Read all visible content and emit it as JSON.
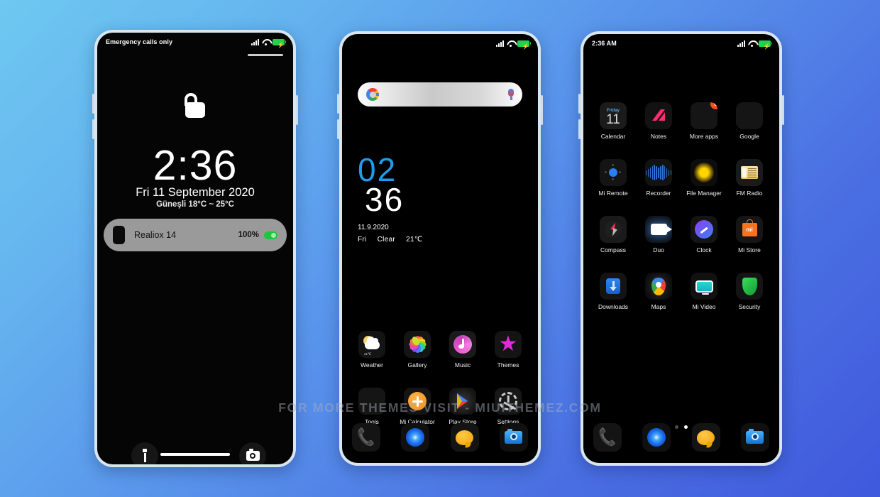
{
  "background": {
    "top_left_color": "#6ec8f0",
    "bottom_right_color": "#4059dd"
  },
  "watermark": {
    "text": "FOR MORE THEMES VISIT - MIUITHEMEZ.COM"
  },
  "lockscreen": {
    "statusbar": {
      "carrier": "Emergency calls only",
      "signal_icon": "signal-bars-icon",
      "wifi_icon": "wifi-icon",
      "battery_icon": "battery-charging-icon"
    },
    "lock_icon": "unlocked-padlock-icon",
    "time": "2:36",
    "date": "Fri 11 September 2020",
    "weather": "Güneşli  18°C ~ 25°C",
    "notification": {
      "icon": "phone-device-icon",
      "title": "Realiox 14",
      "percent": "100%",
      "battery_icon": "battery-full-icon"
    },
    "shortcuts": [
      {
        "name": "flashlight-shortcut",
        "icon": "flashlight-icon"
      },
      {
        "name": "camera-shortcut",
        "icon": "camera-icon"
      }
    ],
    "home_indicator": "home-indicator-bar"
  },
  "homescreen": {
    "statusbar": {
      "carrier": "",
      "signal_icon": "signal-bars-icon",
      "wifi_icon": "wifi-icon",
      "battery_icon": "battery-charging-icon"
    },
    "search": {
      "placeholder": "",
      "left_icon": "google-logo-icon",
      "right_icon": "microphone-icon"
    },
    "clock_widget": {
      "hour": "02",
      "minute": "36",
      "date": "11.9.2020",
      "weekday": "Fri",
      "condition": "Clear",
      "temperature": "21℃"
    },
    "apps": [
      {
        "label": "Weather",
        "icon": "weather-app-icon",
        "temp": "21℃"
      },
      {
        "label": "Gallery",
        "icon": "gallery-app-icon"
      },
      {
        "label": "Music",
        "icon": "music-app-icon"
      },
      {
        "label": "Themes",
        "icon": "themes-app-icon"
      },
      {
        "label": "Tools",
        "icon": "tools-folder-icon"
      },
      {
        "label": "Mi Calculator",
        "icon": "calculator-app-icon"
      },
      {
        "label": "Play Store",
        "icon": "play-store-app-icon"
      },
      {
        "label": "Settings",
        "icon": "settings-app-icon"
      }
    ],
    "dock": [
      {
        "label": "Phone",
        "icon": "phone-app-icon"
      },
      {
        "label": "Browser",
        "icon": "browser-app-icon"
      },
      {
        "label": "Messages",
        "icon": "messages-app-icon"
      },
      {
        "label": "Camera",
        "icon": "camera-app-icon"
      }
    ]
  },
  "appdrawer": {
    "statusbar": {
      "time": "2:36 AM",
      "signal_icon": "signal-bars-icon",
      "wifi_icon": "wifi-icon",
      "battery_icon": "battery-charging-icon"
    },
    "apps": [
      {
        "label": "Calendar",
        "icon": "calendar-app-icon",
        "weekday": "Friday",
        "day": "11"
      },
      {
        "label": "Notes",
        "icon": "notes-app-icon"
      },
      {
        "label": "More apps",
        "icon": "more-apps-folder-icon",
        "badge": "6"
      },
      {
        "label": "Google",
        "icon": "google-folder-icon"
      },
      {
        "label": "Mi Remote",
        "icon": "mi-remote-app-icon"
      },
      {
        "label": "Recorder",
        "icon": "recorder-app-icon"
      },
      {
        "label": "File Manager",
        "icon": "file-manager-app-icon"
      },
      {
        "label": "FM Radio",
        "icon": "fm-radio-app-icon"
      },
      {
        "label": "Compass",
        "icon": "compass-app-icon"
      },
      {
        "label": "Duo",
        "icon": "duo-app-icon"
      },
      {
        "label": "Clock",
        "icon": "clock-app-icon"
      },
      {
        "label": "Mi Store",
        "icon": "mi-store-app-icon"
      },
      {
        "label": "Downloads",
        "icon": "downloads-app-icon"
      },
      {
        "label": "Maps",
        "icon": "maps-app-icon"
      },
      {
        "label": "Mi Video",
        "icon": "mi-video-app-icon"
      },
      {
        "label": "Security",
        "icon": "security-app-icon"
      }
    ],
    "page_indicator": {
      "count": 2,
      "active": 2
    },
    "dock": [
      {
        "label": "Phone",
        "icon": "phone-app-icon"
      },
      {
        "label": "Browser",
        "icon": "browser-app-icon"
      },
      {
        "label": "Messages",
        "icon": "messages-app-icon"
      },
      {
        "label": "Camera",
        "icon": "camera-app-icon"
      }
    ]
  }
}
